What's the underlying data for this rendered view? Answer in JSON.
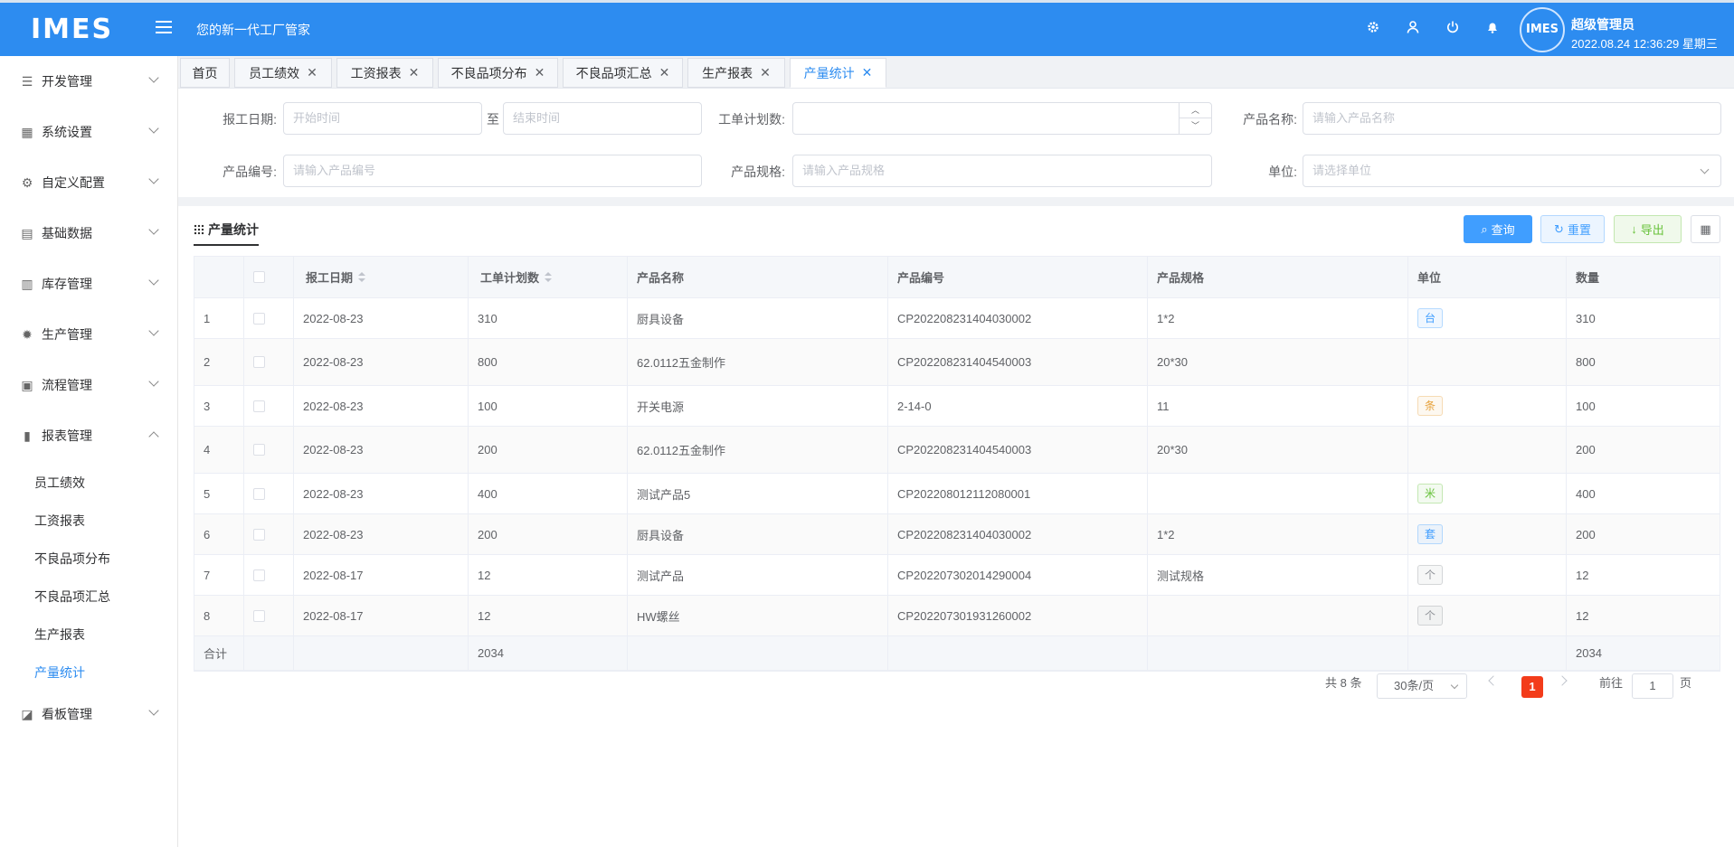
{
  "header": {
    "logo": "IMES",
    "slogan": "您的新一代工厂管家",
    "avatar_text": "IMES",
    "user_name": "超级管理员",
    "datetime": "2022.08.24 12:36:29 星期三"
  },
  "sidebar": {
    "menus": [
      {
        "label": "开发管理",
        "icon": "sliders-icon"
      },
      {
        "label": "系统设置",
        "icon": "grid-icon"
      },
      {
        "label": "自定义配置",
        "icon": "gear-icon"
      },
      {
        "label": "基础数据",
        "icon": "book-icon"
      },
      {
        "label": "库存管理",
        "icon": "clipboard-icon"
      },
      {
        "label": "生产管理",
        "icon": "cog-icon"
      },
      {
        "label": "流程管理",
        "icon": "flow-icon"
      },
      {
        "label": "报表管理",
        "icon": "bar-chart-icon"
      },
      {
        "label": "看板管理",
        "icon": "line-chart-icon"
      }
    ],
    "report_sub": [
      "员工绩效",
      "工资报表",
      "不良品项分布",
      "不良品项汇总",
      "生产报表",
      "产量统计"
    ]
  },
  "tabs": [
    {
      "label": "首页"
    },
    {
      "label": "员工绩效"
    },
    {
      "label": "工资报表"
    },
    {
      "label": "不良品项分布"
    },
    {
      "label": "不良品项汇总"
    },
    {
      "label": "生产报表"
    },
    {
      "label": "产量统计"
    }
  ],
  "filters": {
    "report_date_label": "报工日期:",
    "start_placeholder": "开始时间",
    "to": "至",
    "end_placeholder": "结束时间",
    "plan_qty_label": "工单计划数:",
    "product_name_label": "产品名称:",
    "product_name_placeholder": "请输入产品名称",
    "product_code_label": "产品编号:",
    "product_code_placeholder": "请输入产品编号",
    "product_spec_label": "产品规格:",
    "product_spec_placeholder": "请输入产品规格",
    "unit_label": "单位:",
    "unit_placeholder": "请选择单位"
  },
  "card": {
    "title": "产量统计",
    "query": "查询",
    "reset": "重置",
    "export": "导出"
  },
  "table": {
    "headers": [
      "",
      "",
      "报工日期",
      "工单计划数",
      "产品名称",
      "产品编号",
      "产品规格",
      "单位",
      "数量"
    ],
    "rows": [
      {
        "idx": "1",
        "date": "2022-08-23",
        "plan": "310",
        "name": "厨具设备",
        "code": "CP202208231404030002",
        "spec": "1*2",
        "unit": "台",
        "unit_color": "#409eff",
        "qty": "310"
      },
      {
        "idx": "2",
        "date": "2022-08-23",
        "plan": "800",
        "name": "62.0112五金制作",
        "code": "CP202208231404540003",
        "spec": "20*30",
        "unit": "",
        "unit_color": "",
        "qty": "800"
      },
      {
        "idx": "3",
        "date": "2022-08-23",
        "plan": "100",
        "name": "开关电源",
        "code": "2-14-0",
        "spec": "11",
        "unit": "条",
        "unit_color": "#e6a23c",
        "qty": "100"
      },
      {
        "idx": "4",
        "date": "2022-08-23",
        "plan": "200",
        "name": "62.0112五金制作",
        "code": "CP202208231404540003",
        "spec": "20*30",
        "unit": "",
        "unit_color": "",
        "qty": "200"
      },
      {
        "idx": "5",
        "date": "2022-08-23",
        "plan": "400",
        "name": "测试产品5",
        "code": "CP202208012112080001",
        "spec": "",
        "unit": "米",
        "unit_color": "#67c23a",
        "qty": "400"
      },
      {
        "idx": "6",
        "date": "2022-08-23",
        "plan": "200",
        "name": "厨具设备",
        "code": "CP202208231404030002",
        "spec": "1*2",
        "unit": "套",
        "unit_color": "#409eff",
        "qty": "200"
      },
      {
        "idx": "7",
        "date": "2022-08-17",
        "plan": "12",
        "name": "测试产品",
        "code": "CP202207302014290004",
        "spec": "测试规格",
        "unit": "个",
        "unit_color": "#909399",
        "qty": "12"
      },
      {
        "idx": "8",
        "date": "2022-08-17",
        "plan": "12",
        "name": "HW螺丝",
        "code": "CP202207301931260002",
        "spec": "",
        "unit": "个",
        "unit_color": "#909399",
        "qty": "12"
      }
    ],
    "summary": {
      "label": "合计",
      "plan": "2034",
      "qty": "2034"
    }
  },
  "pagination": {
    "total": "共 8 条",
    "page_size": "30条/页",
    "current": "1",
    "goto": "前往",
    "goto_value": "1",
    "page": "页"
  }
}
